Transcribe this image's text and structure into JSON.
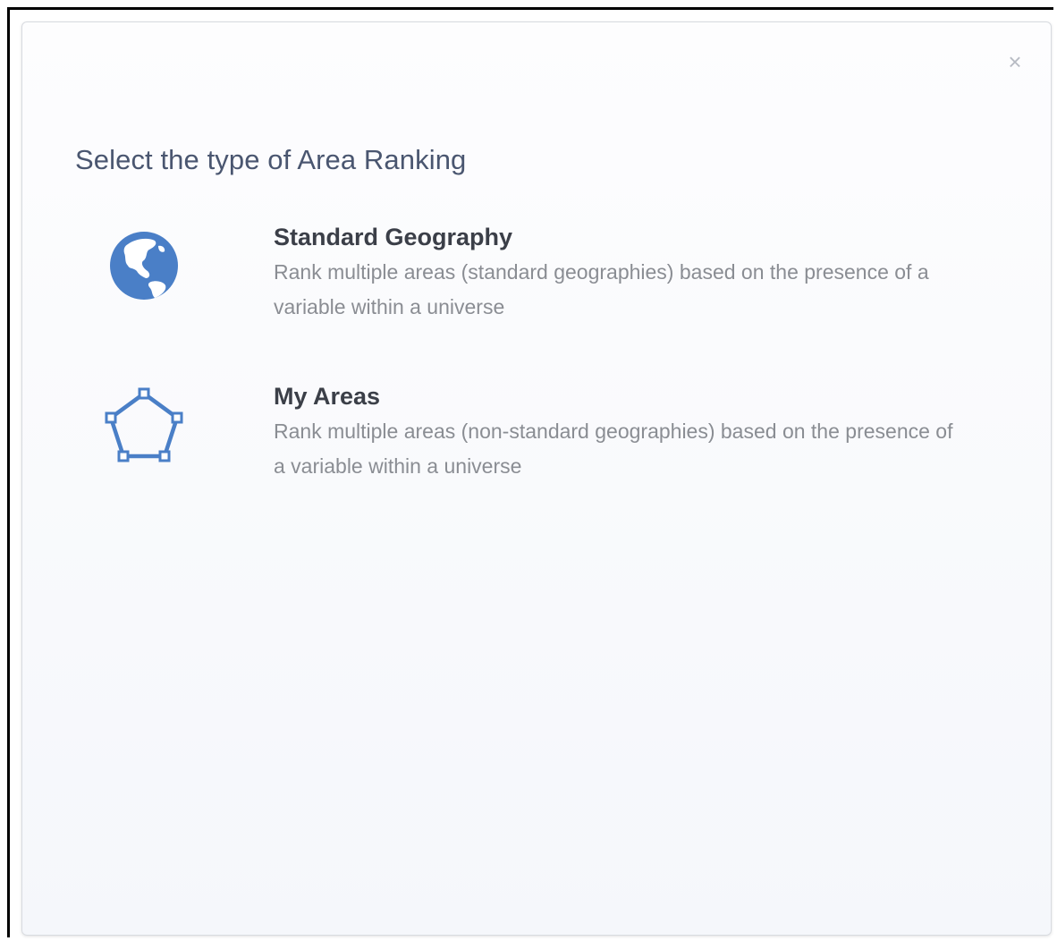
{
  "dialog": {
    "title": "Select the type of Area Ranking",
    "close_label": "×",
    "options": [
      {
        "title": "Standard Geography",
        "description": "Rank multiple areas (standard geographies) based on the presence of a variable within a universe",
        "icon": "globe-icon"
      },
      {
        "title": "My Areas",
        "description": "Rank multiple areas (non-standard geographies) based on the presence of a variable within a universe",
        "icon": "polygon-icon"
      }
    ]
  },
  "colors": {
    "icon_blue": "#4a7fc7",
    "title_text": "#4a5670",
    "option_title": "#3b3f48",
    "option_desc": "#8a8d93"
  }
}
